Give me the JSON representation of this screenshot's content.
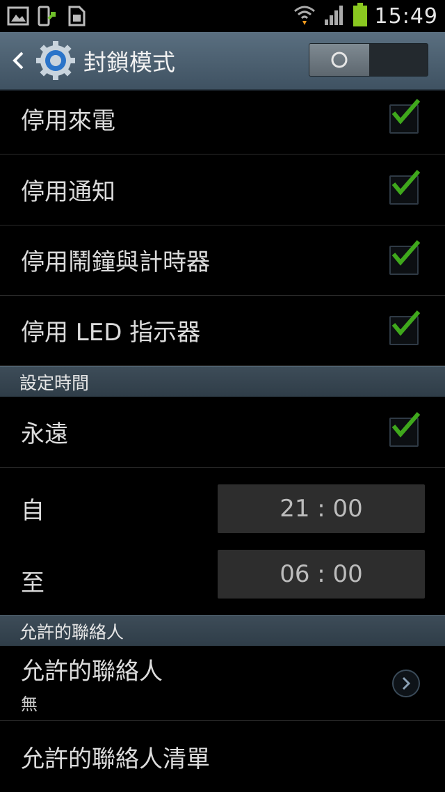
{
  "status_bar": {
    "time": "15:49"
  },
  "action_bar": {
    "title": "封鎖模式",
    "toggle_on": false
  },
  "block_options": [
    {
      "label": "停用來電",
      "checked": true
    },
    {
      "label": "停用通知",
      "checked": true
    },
    {
      "label": "停用鬧鐘與計時器",
      "checked": true
    },
    {
      "label": "停用 LED 指示器",
      "checked": true
    }
  ],
  "set_time": {
    "header": "設定時間",
    "always_label": "永遠",
    "always_checked": true,
    "from_label": "自",
    "from_value": "21 : 00",
    "to_label": "至",
    "to_value": "06 : 00"
  },
  "contacts": {
    "header": "允許的聯絡人",
    "allowed_label": "允許的聯絡人",
    "allowed_value": "無",
    "list_label": "允許的聯絡人清單"
  },
  "colors": {
    "check": "#3fa81c",
    "action_bar": "#4a5e6e",
    "section": "#36444f"
  }
}
